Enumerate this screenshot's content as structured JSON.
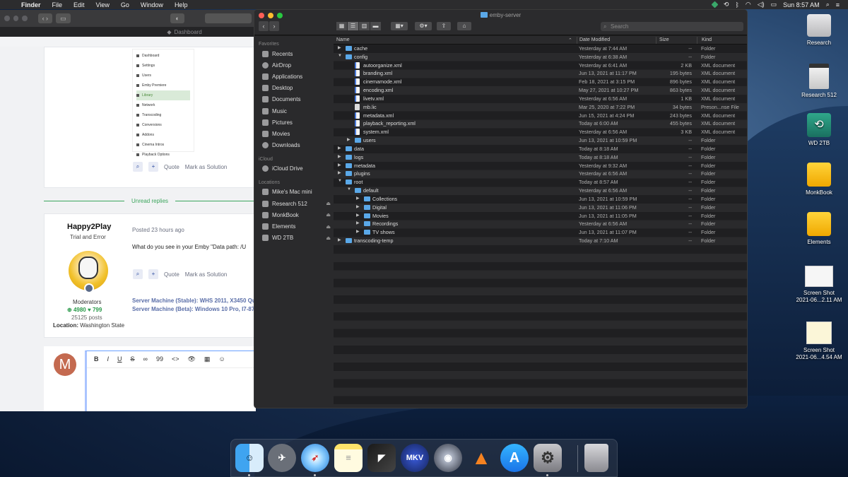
{
  "menubar": {
    "app_name": "Finder",
    "menus": [
      "File",
      "Edit",
      "View",
      "Go",
      "Window",
      "Help"
    ],
    "clock": "Sun 8:57 AM"
  },
  "browser": {
    "tab_title": "Dashboard",
    "thumbnail_items": [
      "Dashboard",
      "Settings",
      "Users",
      "Emby Premiere",
      "Library",
      "Network",
      "Transcoding",
      "Conversions",
      "Addons",
      "Cinema Intros",
      "Playback Options"
    ],
    "actions": {
      "quote": "Quote",
      "mark_solution": "Mark as Solution"
    },
    "unread_label": "Unread replies",
    "post": {
      "username": "Happy2Play",
      "user_title": "Trial and Error",
      "role": "Moderators",
      "rep_positive": "4980",
      "rep_other": "799",
      "post_count": "25125 posts",
      "location_label": "Location:",
      "location_value": "Washington State",
      "posted": "Posted 23 hours ago",
      "message": "What do you see in your Emby \"Data path: /U",
      "sig1": "Server Machine (Stable): WHS 2011, X3450 Qu",
      "sig2": "Server Machine (Beta): Windows 10 Pro, I7-87"
    },
    "reply": {
      "avatar_letter": "M",
      "toolbar": [
        "B",
        "I",
        "U",
        "S",
        "∞",
        "99",
        "<>",
        "👁",
        "▦",
        "☺"
      ]
    }
  },
  "finder": {
    "window_title": "emby-server",
    "search_placeholder": "Search",
    "sidebar": {
      "favorites_head": "Favorites",
      "favorites": [
        "Recents",
        "AirDrop",
        "Applications",
        "Desktop",
        "Documents",
        "Music",
        "Pictures",
        "Movies",
        "Downloads"
      ],
      "icloud_head": "iCloud",
      "icloud": [
        "iCloud Drive"
      ],
      "locations_head": "Locations",
      "locations": [
        "Mike's Mac mini",
        "Research 512",
        "MonkBook",
        "Elements",
        "WD 2TB"
      ]
    },
    "columns": {
      "name": "Name",
      "date": "Date Modified",
      "size": "Size",
      "kind": "Kind"
    },
    "rows": [
      {
        "name": "cache",
        "date": "Yesterday at 7:44 AM",
        "size": "--",
        "kind": "Folder"
      },
      {
        "name": "config",
        "date": "Yesterday at 6:38 AM",
        "size": "--",
        "kind": "Folder"
      },
      {
        "name": "autoorganize.xml",
        "date": "Yesterday at 6:41 AM",
        "size": "2 KB",
        "kind": "XML document"
      },
      {
        "name": "branding.xml",
        "date": "Jun 13, 2021 at 11:17 PM",
        "size": "195 bytes",
        "kind": "XML document"
      },
      {
        "name": "cinemamode.xml",
        "date": "Feb 18, 2021 at 3:15 PM",
        "size": "896 bytes",
        "kind": "XML document"
      },
      {
        "name": "encoding.xml",
        "date": "May 27, 2021 at 10:27 PM",
        "size": "863 bytes",
        "kind": "XML document"
      },
      {
        "name": "livetv.xml",
        "date": "Yesterday at 6:56 AM",
        "size": "1 KB",
        "kind": "XML document"
      },
      {
        "name": "mb.lic",
        "date": "Mar 25, 2020 at 7:22 PM",
        "size": "34 bytes",
        "kind": "Preson...nse File"
      },
      {
        "name": "metadata.xml",
        "date": "Jun 15, 2021 at 4:24 PM",
        "size": "243 bytes",
        "kind": "XML document"
      },
      {
        "name": "playback_reporting.xml",
        "date": "Today at 6:00 AM",
        "size": "455 bytes",
        "kind": "XML document"
      },
      {
        "name": "system.xml",
        "date": "Yesterday at 6:56 AM",
        "size": "3 KB",
        "kind": "XML document"
      },
      {
        "name": "users",
        "date": "Jun 13, 2021 at 10:59 PM",
        "size": "--",
        "kind": "Folder"
      },
      {
        "name": "data",
        "date": "Today at 8:18 AM",
        "size": "--",
        "kind": "Folder"
      },
      {
        "name": "logs",
        "date": "Today at 8:18 AM",
        "size": "--",
        "kind": "Folder"
      },
      {
        "name": "metadata",
        "date": "Yesterday at 9:32 AM",
        "size": "--",
        "kind": "Folder"
      },
      {
        "name": "plugins",
        "date": "Yesterday at 6:56 AM",
        "size": "--",
        "kind": "Folder"
      },
      {
        "name": "root",
        "date": "Today at 8:57 AM",
        "size": "--",
        "kind": "Folder"
      },
      {
        "name": "default",
        "date": "Yesterday at 6:56 AM",
        "size": "--",
        "kind": "Folder"
      },
      {
        "name": "Collections",
        "date": "Jun 13, 2021 at 10:59 PM",
        "size": "--",
        "kind": "Folder"
      },
      {
        "name": "Digital",
        "date": "Jun 13, 2021 at 11:06 PM",
        "size": "--",
        "kind": "Folder"
      },
      {
        "name": "Movies",
        "date": "Jun 13, 2021 at 11:05 PM",
        "size": "--",
        "kind": "Folder"
      },
      {
        "name": "Recordings",
        "date": "Yesterday at 6:56 AM",
        "size": "--",
        "kind": "Folder"
      },
      {
        "name": "TV shows",
        "date": "Jun 13, 2021 at 11:07 PM",
        "size": "--",
        "kind": "Folder"
      },
      {
        "name": "transcoding-temp",
        "date": "Today at 7:10 AM",
        "size": "--",
        "kind": "Folder"
      }
    ]
  },
  "desktop_icons": [
    {
      "label": "Research",
      "icon": "hard-drive-icon"
    },
    {
      "label": "Research 512",
      "icon": "sd-card-icon"
    },
    {
      "label": "WD 2TB",
      "icon": "time-machine-drive-icon"
    },
    {
      "label": "MonkBook",
      "icon": "external-drive-icon"
    },
    {
      "label": "Elements",
      "icon": "external-drive-icon"
    },
    {
      "label": "Screen Shot",
      "label2": "2021-06...2.11 AM",
      "icon": "screenshot-icon"
    },
    {
      "label": "Screen Shot",
      "label2": "2021-06...4.54 AM",
      "icon": "screenshot-icon"
    }
  ],
  "dock": {
    "apps": [
      "finder-icon",
      "launchpad-icon",
      "safari-icon",
      "notes-icon",
      "infuse-icon",
      "mkv-icon",
      "media-player-icon",
      "vlc-icon",
      "app-store-icon",
      "system-preferences-icon",
      "trash-icon"
    ],
    "mkv_label": "MKV"
  }
}
